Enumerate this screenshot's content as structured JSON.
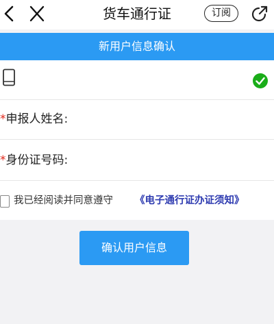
{
  "header": {
    "title": "货车通行证",
    "subscribe_label": "订阅",
    "back_icon": "chevron-left-icon",
    "close_icon": "close-icon",
    "share_icon": "share-icon"
  },
  "banner": {
    "title": "新用户信息确认",
    "color": "#2b9af3"
  },
  "form": {
    "phone": {
      "icon": "phone-icon",
      "value": "",
      "verified_icon": "check-circle-icon",
      "verified_color": "#1aad19"
    },
    "name": {
      "required_mark": "*",
      "label": "申报人姓名:",
      "value": ""
    },
    "id_number": {
      "required_mark": "*",
      "label": "身份证号码:",
      "value": ""
    },
    "agreement": {
      "checked": false,
      "text": "我已经阅读并同意遵守",
      "link_text": "《电子通行证办证须知》"
    }
  },
  "actions": {
    "confirm_label": "确认用户信息"
  }
}
